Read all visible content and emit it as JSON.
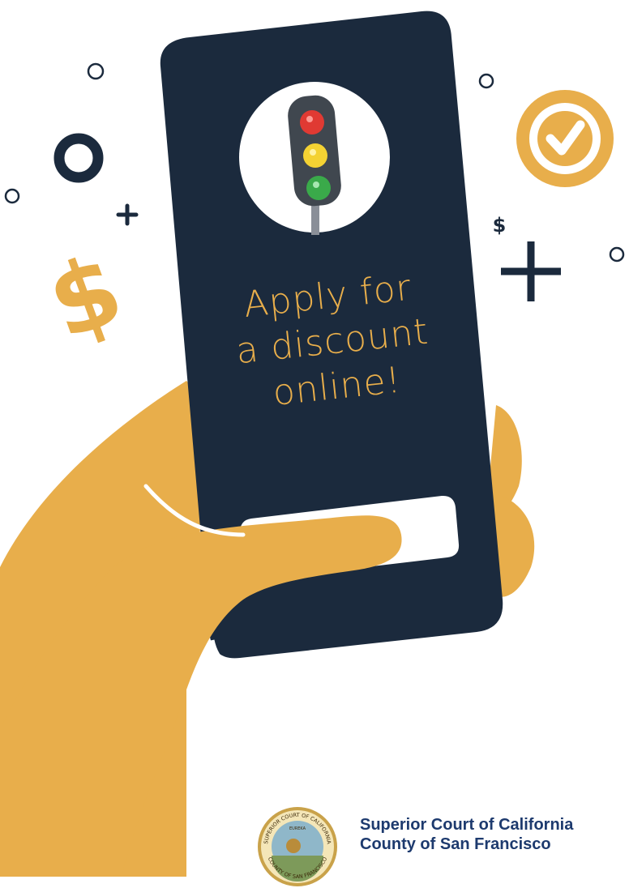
{
  "headline": {
    "line1": "Apply for",
    "line2": "a discount",
    "line3": "online!"
  },
  "court": {
    "line1": "Superior Court of California",
    "line2": "County of San Francisco"
  },
  "seal": {
    "top_text": "SUPERIOR COURT OF CALIFORNIA",
    "bottom_text": "COUNTY OF SAN FRANCISCO",
    "motto": "EUREKA"
  },
  "decorations": {
    "dollar_large": "$",
    "dollar_small": "$"
  },
  "colors": {
    "phone": "#1b2a3d",
    "accent": "#e8ae4b",
    "court_text": "#1d3a6e"
  },
  "icons": [
    "traffic-light-icon",
    "checkmark-icon",
    "dollar-icon",
    "plus-icon",
    "circle-icon"
  ]
}
